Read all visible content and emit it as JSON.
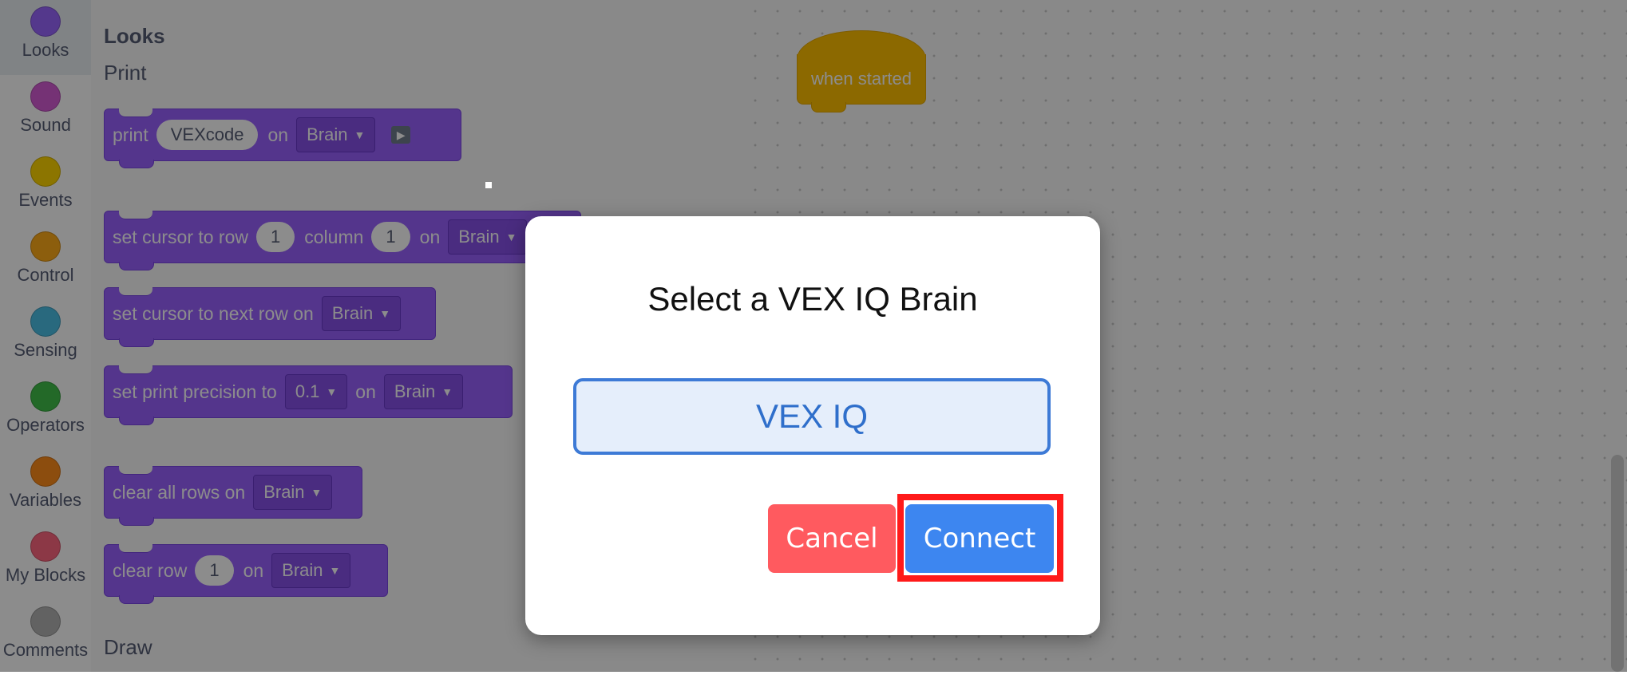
{
  "categories": [
    {
      "label": "Looks",
      "color": "#9966ff"
    },
    {
      "label": "Sound",
      "color": "#d65cd6"
    },
    {
      "label": "Events",
      "color": "#ffd500"
    },
    {
      "label": "Control",
      "color": "#ffab19"
    },
    {
      "label": "Sensing",
      "color": "#4cbfe6"
    },
    {
      "label": "Operators",
      "color": "#40bf4a"
    },
    {
      "label": "Variables",
      "color": "#ff8c1a"
    },
    {
      "label": "My Blocks",
      "color": "#ff6680"
    },
    {
      "label": "Comments",
      "color": "#b3b3b3"
    }
  ],
  "flyout": {
    "looks_title": "Looks",
    "print_title": "Print",
    "draw_title": "Draw",
    "print_block": {
      "text": "print",
      "value": "VEXcode",
      "on": "on",
      "target": "Brain"
    },
    "set_cursor_block": {
      "text": "set cursor to row",
      "row": "1",
      "column_text": "column",
      "column": "1",
      "on": "on",
      "target": "Brain"
    },
    "next_row_block": {
      "text": "set cursor to next row on",
      "target": "Brain"
    },
    "precision_block": {
      "text": "set print precision to",
      "value": "0.1",
      "on": "on",
      "target": "Brain"
    },
    "clear_all_block": {
      "text": "clear all rows on",
      "target": "Brain"
    },
    "clear_row_block": {
      "text": "clear row",
      "value": "1",
      "on": "on",
      "target": "Brain"
    }
  },
  "workspace": {
    "hat_block": "when started"
  },
  "dialog": {
    "title": "Select a VEX IQ Brain",
    "option": "VEX IQ",
    "cancel_label": "Cancel",
    "connect_label": "Connect"
  },
  "colors": {
    "looks_block": "#9a62ff",
    "event_block": "#ffbf00",
    "cancel": "#ff5a5f",
    "connect": "#3d86f0",
    "highlight": "#ff1a1a"
  }
}
